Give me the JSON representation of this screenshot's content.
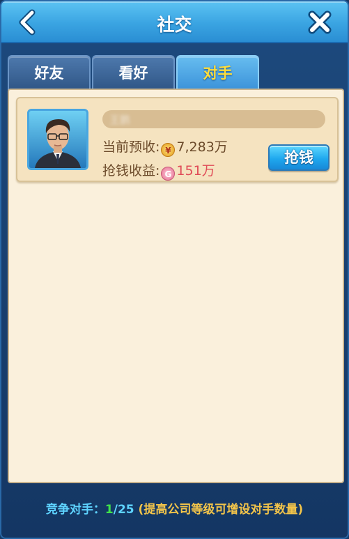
{
  "header": {
    "title": "社交",
    "back_icon": "chevron-left-icon",
    "close_icon": "close-icon"
  },
  "tabs": [
    {
      "label": "好友",
      "active": false
    },
    {
      "label": "看好",
      "active": false
    },
    {
      "label": "对手",
      "active": true
    }
  ],
  "opponents": [
    {
      "name": "王鹏",
      "expected_label": "当前预收:",
      "expected_value": "7,283万",
      "grab_label": "抢钱收益:",
      "grab_value": "151万",
      "button_label": "抢钱"
    }
  ],
  "footer": {
    "label": "竞争对手：",
    "current": "1",
    "total": "/25",
    "note": "(提高公司等级可增设对手数量)"
  },
  "colors": {
    "title_bar": "#3aa4e2",
    "active_tab_text": "#ffde3b",
    "panel_bg": "#faf0dc",
    "grab_value": "#e04b57",
    "footer_current": "#3fe34a",
    "footer_note": "#f2c44a"
  }
}
